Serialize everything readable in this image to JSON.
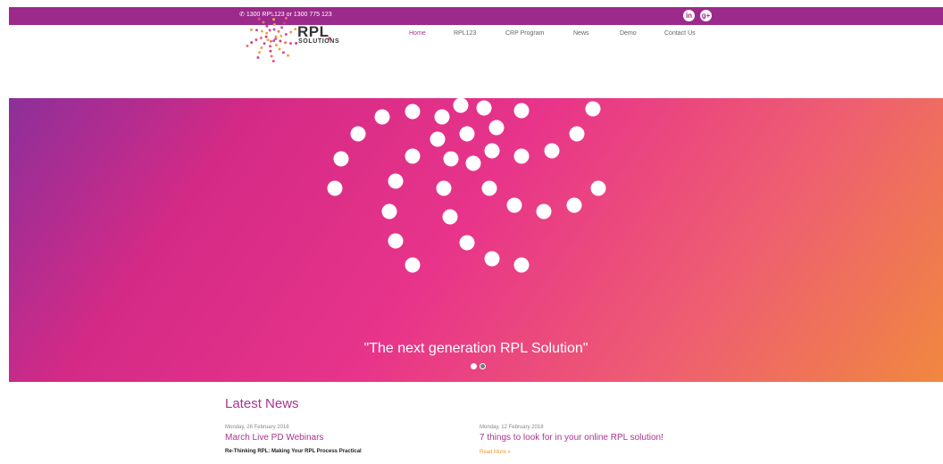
{
  "topbar": {
    "phone": "1300 RPL123 or 1300 775 123",
    "phone_icon": "phone-icon",
    "social": [
      {
        "name": "linkedin-icon",
        "glyph": "in"
      },
      {
        "name": "google-plus-icon",
        "glyph": "g+"
      }
    ]
  },
  "logo": {
    "line1": "RPL",
    "line2": "SOLUTIONS"
  },
  "nav": [
    {
      "label": "Home",
      "active": true
    },
    {
      "label": "RPL123",
      "active": false
    },
    {
      "label": "CRP Program",
      "active": false
    },
    {
      "label": "News",
      "active": false
    },
    {
      "label": "Demo",
      "active": false
    },
    {
      "label": "Contact Us",
      "active": false
    }
  ],
  "hero": {
    "tagline": "\"The next generation RPL Solution\"",
    "slides": [
      {
        "active": true
      },
      {
        "active": false
      }
    ]
  },
  "news": {
    "title": "Latest News",
    "items": [
      {
        "date": "Monday, 26 February 2018",
        "headline": "March Live PD Webinars",
        "sub": "Re-Thinking RPL: Making Your RPL Process Practical"
      },
      {
        "date": "Monday, 12 February 2018",
        "headline": "7 things to look for in your online RPL solution!",
        "read_more": "Read More »"
      }
    ]
  },
  "colors": {
    "brand": "#9b2a8a",
    "accent": "#a8358f",
    "link": "#e89b2f"
  }
}
